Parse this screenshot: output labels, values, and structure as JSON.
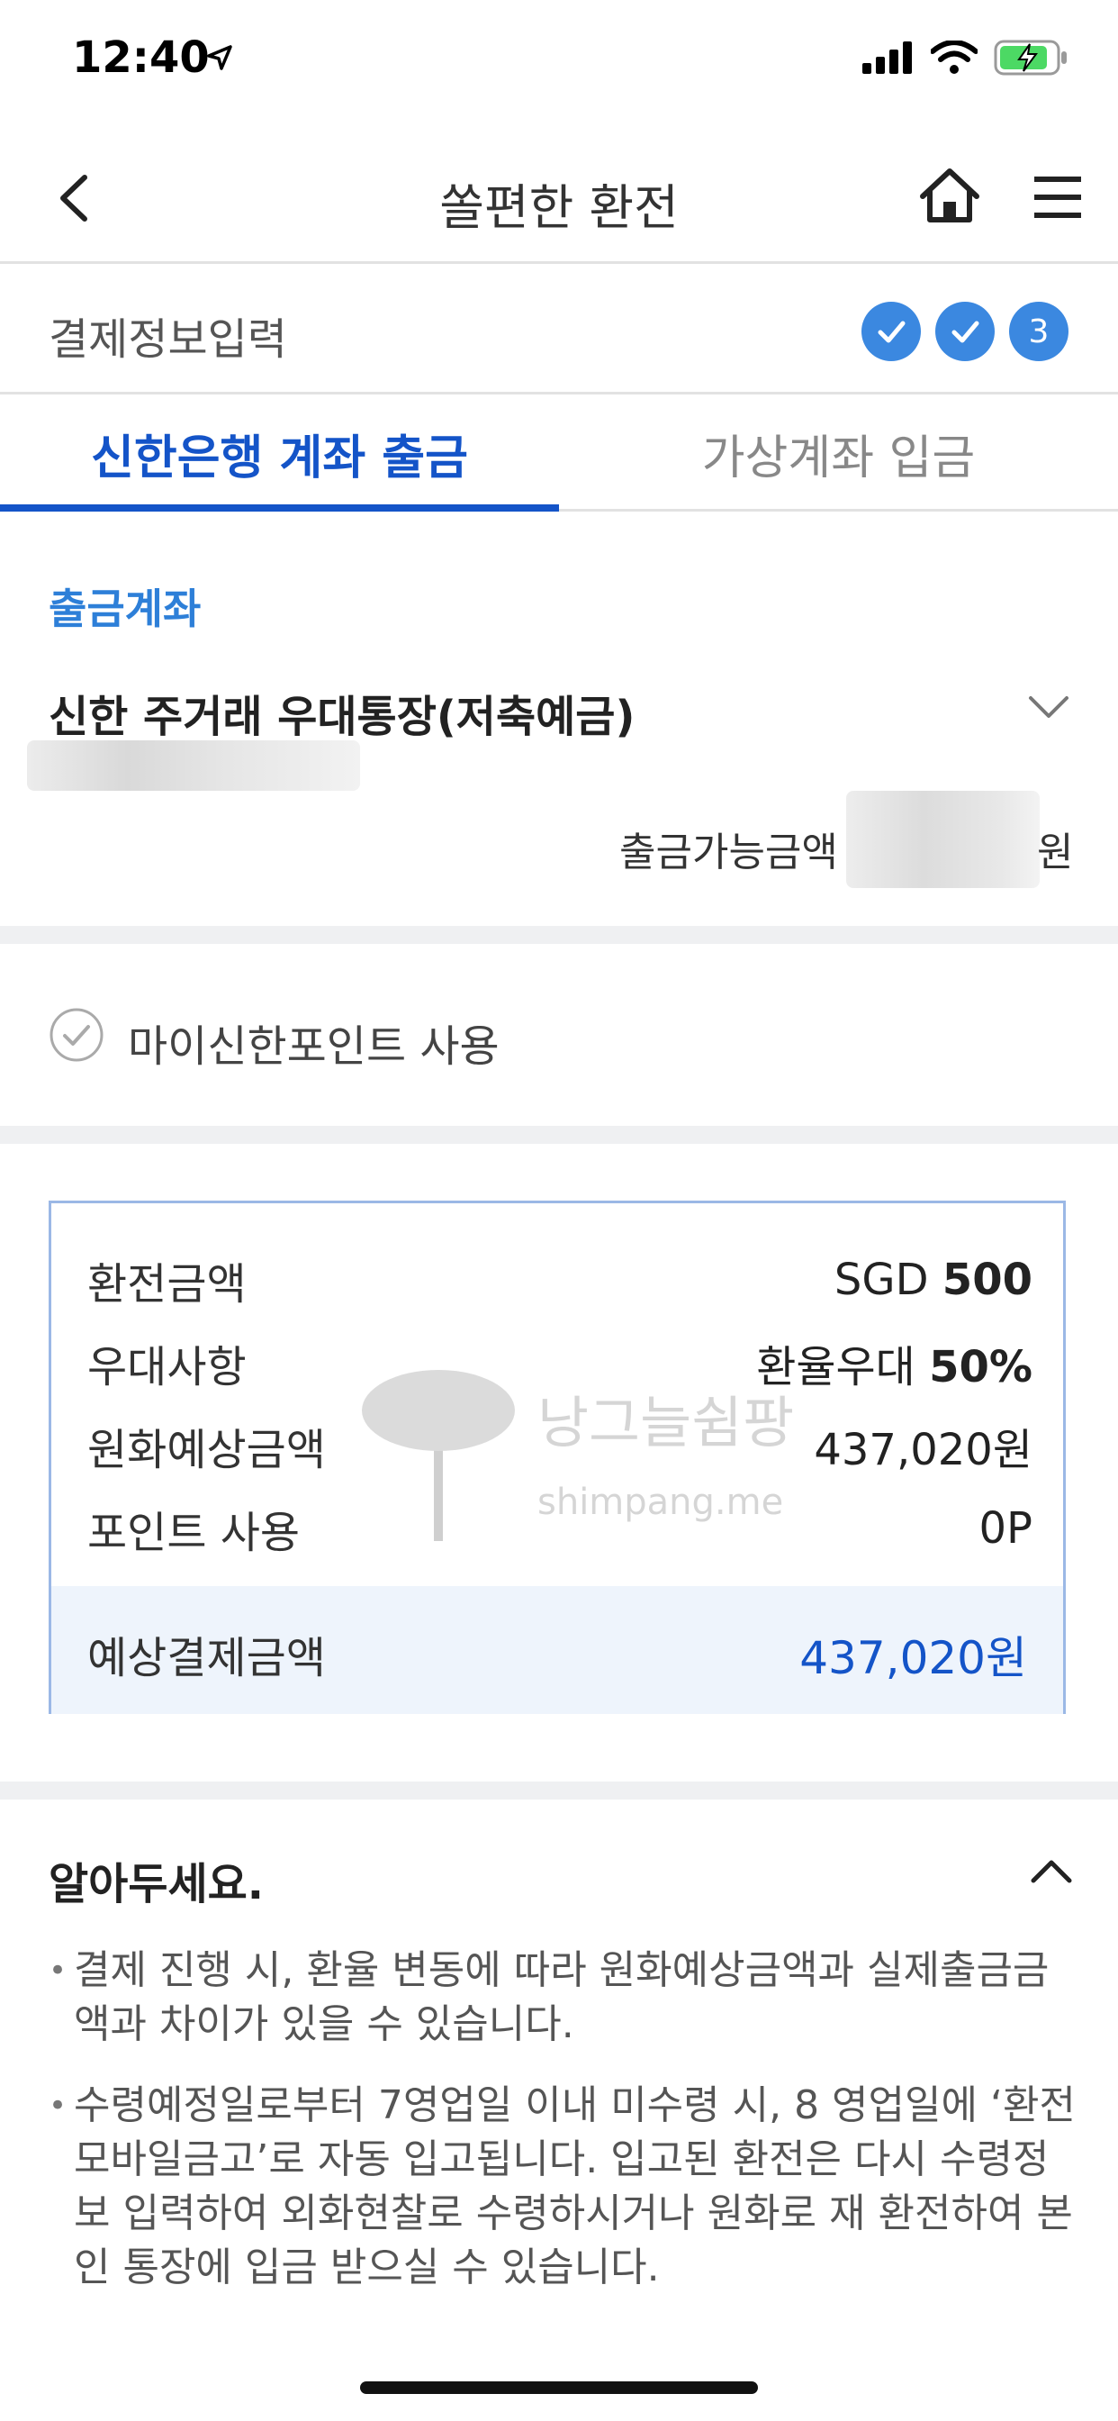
{
  "status_bar": {
    "time": "12:40",
    "icons": [
      "location-arrow-icon",
      "cellular-signal-icon",
      "wifi-icon",
      "battery-charging-icon"
    ]
  },
  "header": {
    "title": "쏠편한 환전"
  },
  "step": {
    "label": "결제정보입력",
    "current_step": "3"
  },
  "tabs": [
    {
      "label": "신한은행 계좌 출금",
      "active": true
    },
    {
      "label": "가상계좌 입금",
      "active": false
    }
  ],
  "account": {
    "section_label": "출금계좌",
    "name": "신한 주거래 우대통장(저축예금)",
    "available_label": "출금가능금액",
    "currency_unit": "원"
  },
  "points": {
    "label": "마이신한포인트 사용"
  },
  "summary": {
    "rows": [
      {
        "label": "환전금액",
        "prefix": "SGD ",
        "value": "500"
      },
      {
        "label": "우대사항",
        "prefix": "환율우대 ",
        "value": "50%"
      },
      {
        "label": "원화예상금액",
        "prefix": "",
        "value": "437,020원"
      },
      {
        "label": "포인트 사용",
        "prefix": "",
        "value": "0P"
      }
    ],
    "total_label": "예상결제금액",
    "total_value": "437,020원",
    "watermark_text": "낭그늘쉼팡",
    "watermark_sub": "shimpang.me"
  },
  "notice": {
    "title": "알아두세요.",
    "items": [
      "결제 진행 시, 환율 변동에 따라 원화예상금액과 실제출금금액과 차이가 있을 수 있습니다.",
      "수령예정일로부터 7영업일 이내 미수령 시, 8 영업일에 ‘환전 모바일금고’로 자동 입고됩니다. 입고된 환전은 다시 수령정보 입력하여 외화현찰로 수령하시거나 원화로 재 환전하여 본인 통장에 입금 받으실 수 있습니다."
    ]
  },
  "colors": {
    "accent": "#1454c8",
    "step_blue": "#3b88e0",
    "section_label": "#2d7fd8",
    "total_bg": "#eef4fc"
  }
}
